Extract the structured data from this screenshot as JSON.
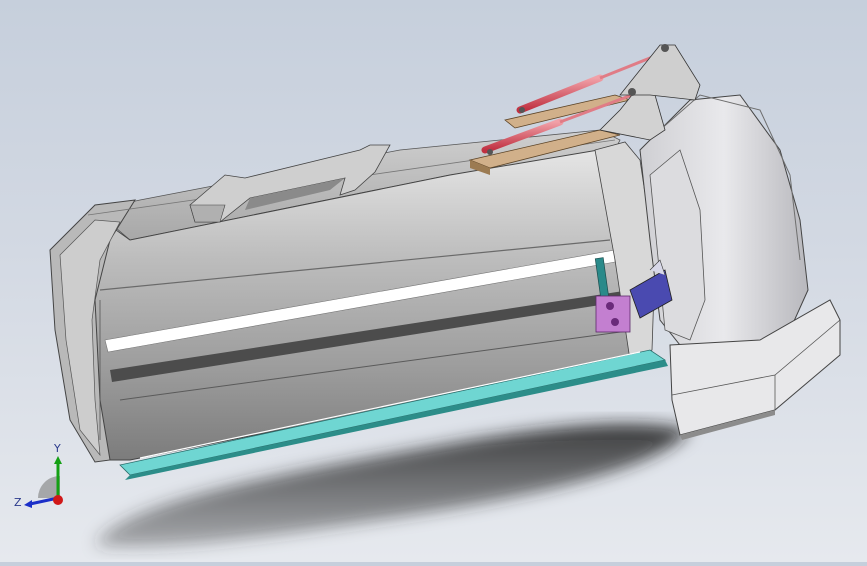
{
  "viewport": {
    "background_top": "#c6cfdc",
    "background_bottom": "#e6e9ee"
  },
  "triad": {
    "x_label": "",
    "y_label": "Y",
    "z_label": "Z",
    "colors": {
      "x": "#d01818",
      "y": "#14a014",
      "z": "#1b2fc8"
    }
  },
  "model": {
    "body_color": "#b6b6b6",
    "cylinder_color": "#d43a4a",
    "rail_color": "#6fd6d2",
    "bracket_color": "#4a4ab0",
    "clamp_color": "#a050b0",
    "support_color": "#2a8a8a"
  }
}
